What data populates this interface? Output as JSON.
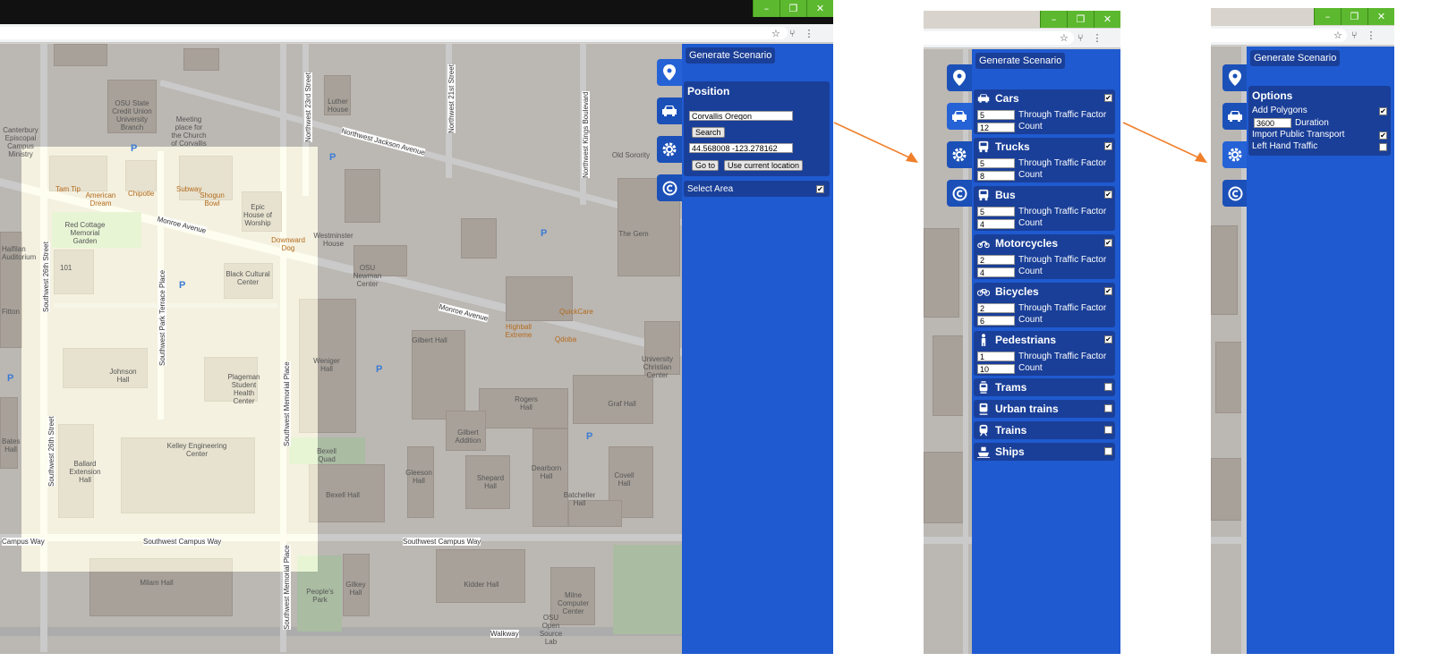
{
  "window_controls": {
    "minimize": "–",
    "restore": "❐",
    "close": "✕"
  },
  "browser_icons": {
    "star": "☆",
    "extension": "⑂",
    "menu": "⋮"
  },
  "tab_icons": [
    "map-pin-icon",
    "car-icon",
    "gear-icon",
    "copyright-icon"
  ],
  "colors": {
    "panel": "#1f5ad0",
    "box": "#1a3f98",
    "window_btn": "#5cb82e",
    "arrow": "#f07f2a"
  },
  "generate_label": "Generate Scenario",
  "map": {
    "streets": [
      "Monroe Avenue",
      "Monroe Avenue",
      "Northwest Jackson Avenue",
      "Southwest Campus Way",
      "Southwest Campus Way",
      "Campus Way",
      "Walkway"
    ],
    "vertical_streets": [
      "Southwest 26th Street",
      "Southwest Park Terrace Place",
      "Southwest Memorial Place",
      "Northwest 23rd Street",
      "Northwest 21st Street",
      "Northwest Kings Boulevard",
      "Southwest 26th Street",
      "Southwest Memorial Place"
    ],
    "places": [
      "Johnson Hall",
      "Kelley Engineering Center",
      "Black Cultural Center",
      "Plageman Student Health Center",
      "Weniger Hall",
      "Gilbert Hall",
      "Rogers Hall",
      "Graf Hall",
      "Gilbert Addition",
      "Dearborn Hall",
      "Covell Hall",
      "Batcheller Hall",
      "Gleeson Hall",
      "Shepard Hall",
      "Bexell Hall",
      "Ballard Extension Hall",
      "Milam Hall",
      "Gilkey Hall",
      "Kidder Hall",
      "Milne Computer Center",
      "Epic House of Worship",
      "Westminster House",
      "OSU Newman Center",
      "Meeting place for the Church of Corvallis",
      "OSU State Credit Union University Branch",
      "Luther House",
      "Old Sorority",
      "The Gem",
      "University Christian Center",
      "Red Cottage Memorial Garden",
      "Bexell Quad",
      "People's Park",
      "OSU Open Source Lab",
      "Canterbury Episcopal Campus Ministry",
      "Bates Hall",
      "Halfilan Auditorium",
      "Fitton"
    ],
    "pois": [
      "Tam Tip",
      "American Dream",
      "Chipotle",
      "Subway",
      "Shogun Bowl",
      "Downward Dog",
      "QuickCare",
      "Highball Extreme",
      "Qdoba"
    ],
    "parking": "P",
    "number": "101"
  },
  "panel1": {
    "position_title": "Position",
    "location_value": "Corvallis Oregon",
    "search_label": "Search",
    "coords_value": "44.568008 -123.278162",
    "goto_label": "Go to",
    "use_current_label": "Use current location",
    "select_area_label": "Select Area",
    "select_area_checked": true
  },
  "panel2": {
    "through_label": "Through Traffic Factor",
    "count_label": "Count",
    "vehicles": [
      {
        "name": "Cars",
        "icon": "car-icon",
        "factor": "5",
        "count": "12",
        "checked": true
      },
      {
        "name": "Trucks",
        "icon": "truck-icon",
        "factor": "5",
        "count": "8",
        "checked": true
      },
      {
        "name": "Bus",
        "icon": "bus-icon",
        "factor": "5",
        "count": "4",
        "checked": true
      },
      {
        "name": "Motorcycles",
        "icon": "motorcycle-icon",
        "factor": "2",
        "count": "4",
        "checked": true
      },
      {
        "name": "Bicycles",
        "icon": "bicycle-icon",
        "factor": "2",
        "count": "6",
        "checked": true
      },
      {
        "name": "Pedestrians",
        "icon": "pedestrian-icon",
        "factor": "1",
        "count": "10",
        "checked": true
      }
    ],
    "modes": [
      {
        "name": "Trams",
        "icon": "tram-icon",
        "checked": false
      },
      {
        "name": "Urban trains",
        "icon": "urban-train-icon",
        "checked": false
      },
      {
        "name": "Trains",
        "icon": "train-icon",
        "checked": false
      },
      {
        "name": "Ships",
        "icon": "ship-icon",
        "checked": false
      }
    ]
  },
  "panel3": {
    "options_title": "Options",
    "add_polygons_label": "Add Polygons",
    "add_polygons_checked": true,
    "duration_value": "3600",
    "duration_label": "Duration",
    "import_pt_label": "Import Public Transport",
    "import_pt_checked": true,
    "left_hand_label": "Left Hand Traffic",
    "left_hand_checked": false
  }
}
